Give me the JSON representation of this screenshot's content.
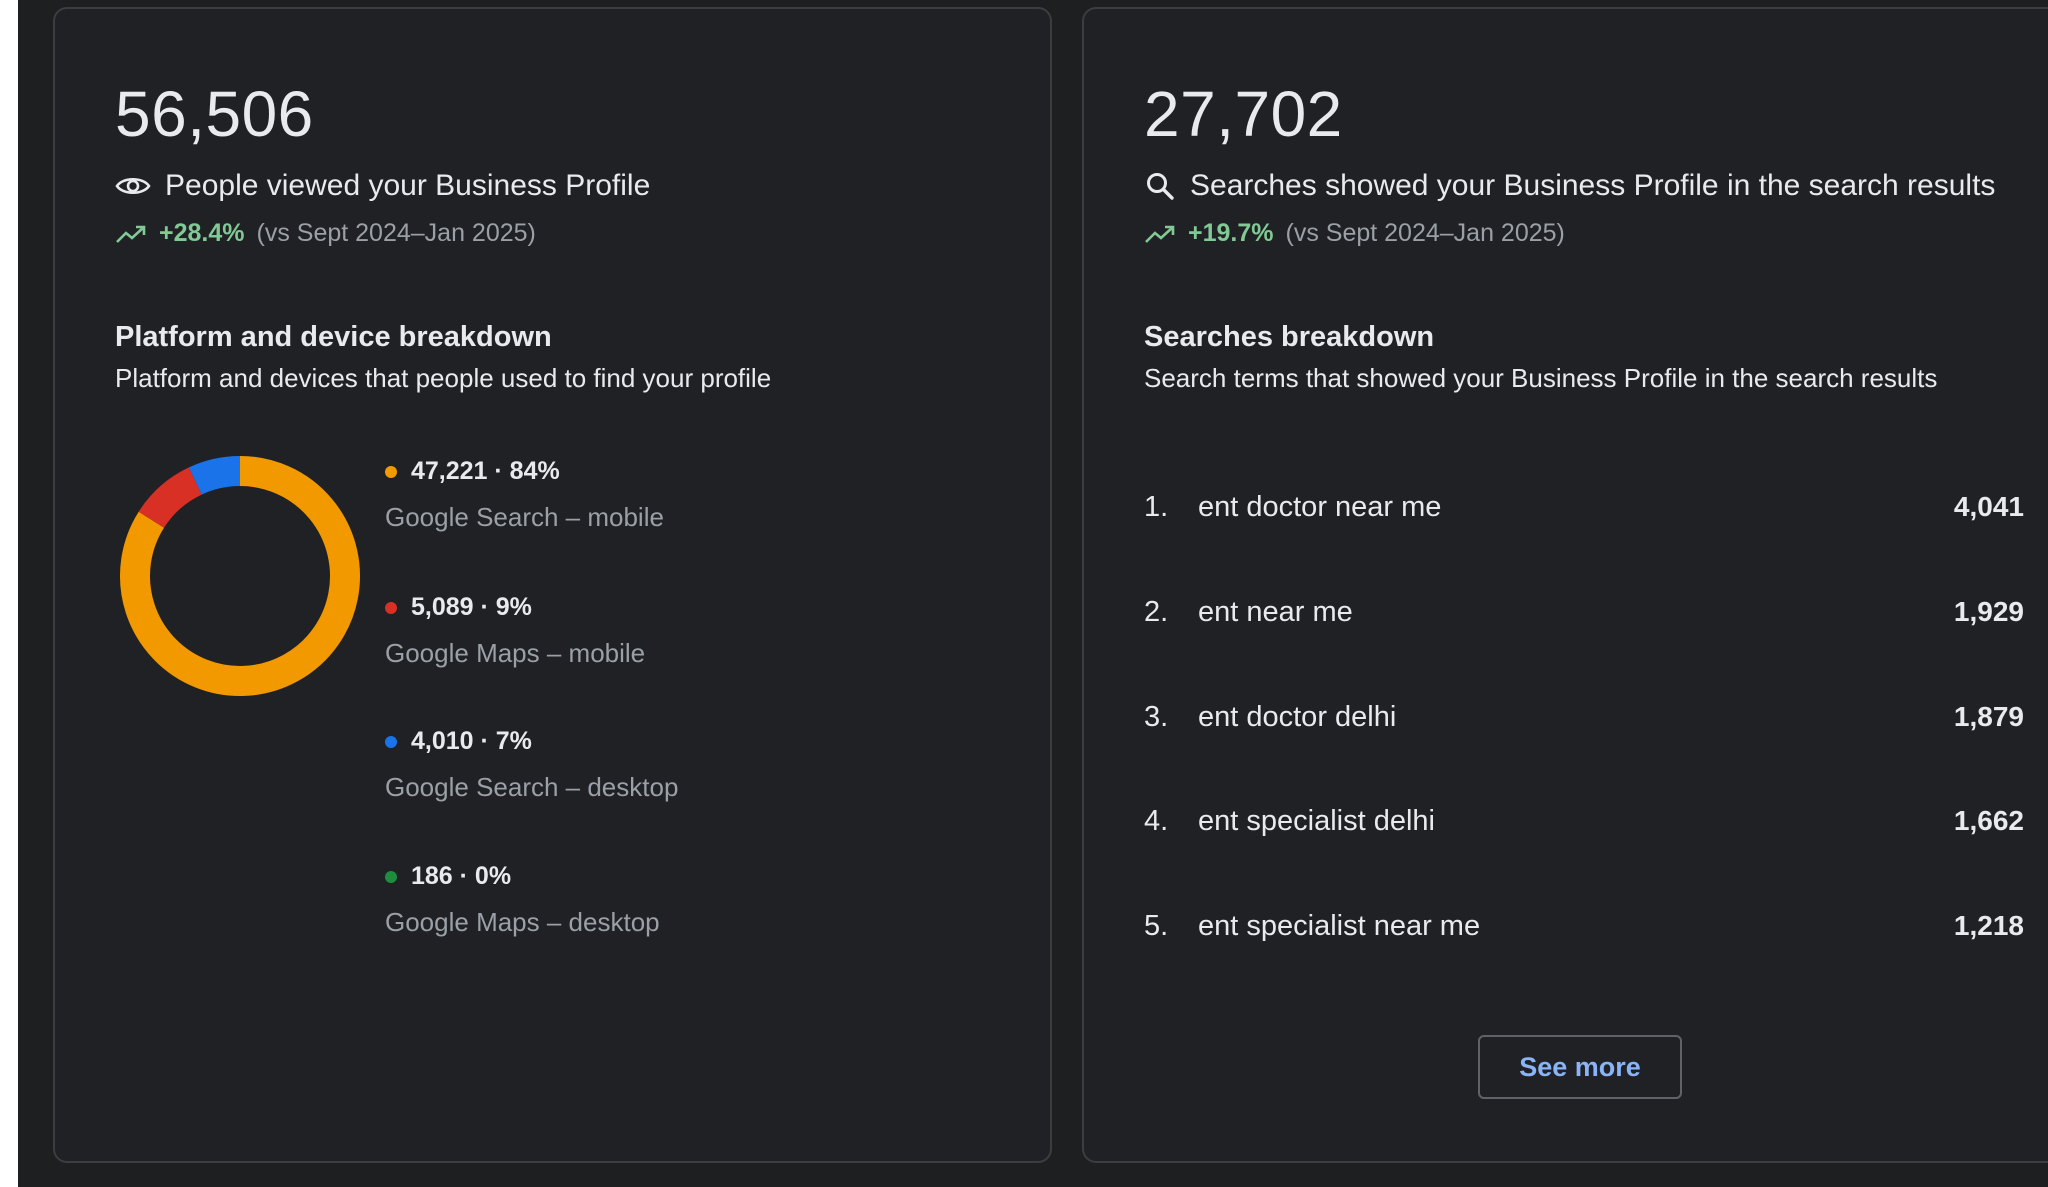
{
  "views_card": {
    "total": "56,506",
    "label": "People viewed your Business Profile",
    "delta": "+28.4%",
    "compare": "(vs Sept 2024–Jan 2025)",
    "section_title": "Platform and device breakdown",
    "section_subtitle": "Platform and devices that people used to find your profile",
    "breakdown": [
      {
        "value": "47,221 · 84%",
        "name": "Google Search – mobile",
        "color": "#f29900",
        "share": 84
      },
      {
        "value": "5,089 · 9%",
        "name": "Google Maps – mobile",
        "color": "#d93025",
        "share": 9
      },
      {
        "value": "4,010 · 7%",
        "name": "Google Search – desktop",
        "color": "#1a73e8",
        "share": 7
      },
      {
        "value": "186 · 0%",
        "name": "Google Maps – desktop",
        "color": "#1e8e3e",
        "share": 0
      }
    ]
  },
  "searches_card": {
    "total": "27,702",
    "label": "Searches showed your Business Profile in the search results",
    "delta": "+19.7%",
    "compare": "(vs Sept 2024–Jan 2025)",
    "section_title": "Searches breakdown",
    "section_subtitle": "Search terms that showed your Business Profile in the search results",
    "terms": [
      {
        "rank": "1.",
        "term": "ent doctor near me",
        "count": "4,041"
      },
      {
        "rank": "2.",
        "term": "ent near me",
        "count": "1,929"
      },
      {
        "rank": "3.",
        "term": "ent doctor delhi",
        "count": "1,879"
      },
      {
        "rank": "4.",
        "term": "ent specialist delhi",
        "count": "1,662"
      },
      {
        "rank": "5.",
        "term": "ent specialist near me",
        "count": "1,218"
      }
    ],
    "see_more_label": "See more"
  },
  "icons": {
    "views": "eye-icon",
    "searches": "search-icon",
    "trend": "trending-up-icon"
  },
  "colors": {
    "positive": "#81c995",
    "link": "#8ab4f8"
  }
}
